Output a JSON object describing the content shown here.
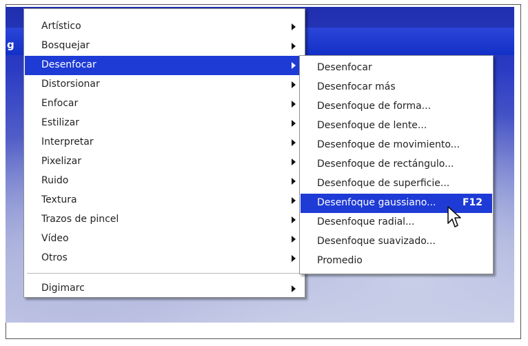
{
  "app": {
    "title_fragment": "g"
  },
  "menu": {
    "items": [
      {
        "label": "Artístico",
        "has_submenu": true,
        "active": false
      },
      {
        "label": "Bosquejar",
        "has_submenu": true,
        "active": false
      },
      {
        "label": "Desenfocar",
        "has_submenu": true,
        "active": true
      },
      {
        "label": "Distorsionar",
        "has_submenu": true,
        "active": false
      },
      {
        "label": "Enfocar",
        "has_submenu": true,
        "active": false
      },
      {
        "label": "Estilizar",
        "has_submenu": true,
        "active": false
      },
      {
        "label": "Interpretar",
        "has_submenu": true,
        "active": false
      },
      {
        "label": "Pixelizar",
        "has_submenu": true,
        "active": false
      },
      {
        "label": "Ruido",
        "has_submenu": true,
        "active": false
      },
      {
        "label": "Textura",
        "has_submenu": true,
        "active": false
      },
      {
        "label": "Trazos de pincel",
        "has_submenu": true,
        "active": false
      },
      {
        "label": "Vídeo",
        "has_submenu": true,
        "active": false
      },
      {
        "label": "Otros",
        "has_submenu": true,
        "active": false
      }
    ],
    "extra_items": [
      {
        "label": "Digimarc",
        "has_submenu": true,
        "active": false
      }
    ]
  },
  "submenu": {
    "items": [
      {
        "label": "Desenfocar",
        "shortcut": "",
        "active": false
      },
      {
        "label": "Desenfocar más",
        "shortcut": "",
        "active": false
      },
      {
        "label": "Desenfoque de forma...",
        "shortcut": "",
        "active": false
      },
      {
        "label": "Desenfoque de lente...",
        "shortcut": "",
        "active": false
      },
      {
        "label": "Desenfoque de movimiento...",
        "shortcut": "",
        "active": false
      },
      {
        "label": "Desenfoque de rectángulo...",
        "shortcut": "",
        "active": false
      },
      {
        "label": "Desenfoque de superficie...",
        "shortcut": "",
        "active": false
      },
      {
        "label": "Desenfoque gaussiano...",
        "shortcut": "F12",
        "active": true
      },
      {
        "label": "Desenfoque radial...",
        "shortcut": "",
        "active": false
      },
      {
        "label": "Desenfoque suavizado...",
        "shortcut": "",
        "active": false
      },
      {
        "label": "Promedio",
        "shortcut": "",
        "active": false
      }
    ]
  },
  "colors": {
    "highlight": "#1e3bd6",
    "menu_bg": "#ffffff"
  },
  "icons": {
    "cursor": "mouse-pointer-icon",
    "submenu_arrow": "chevron-right-icon"
  }
}
